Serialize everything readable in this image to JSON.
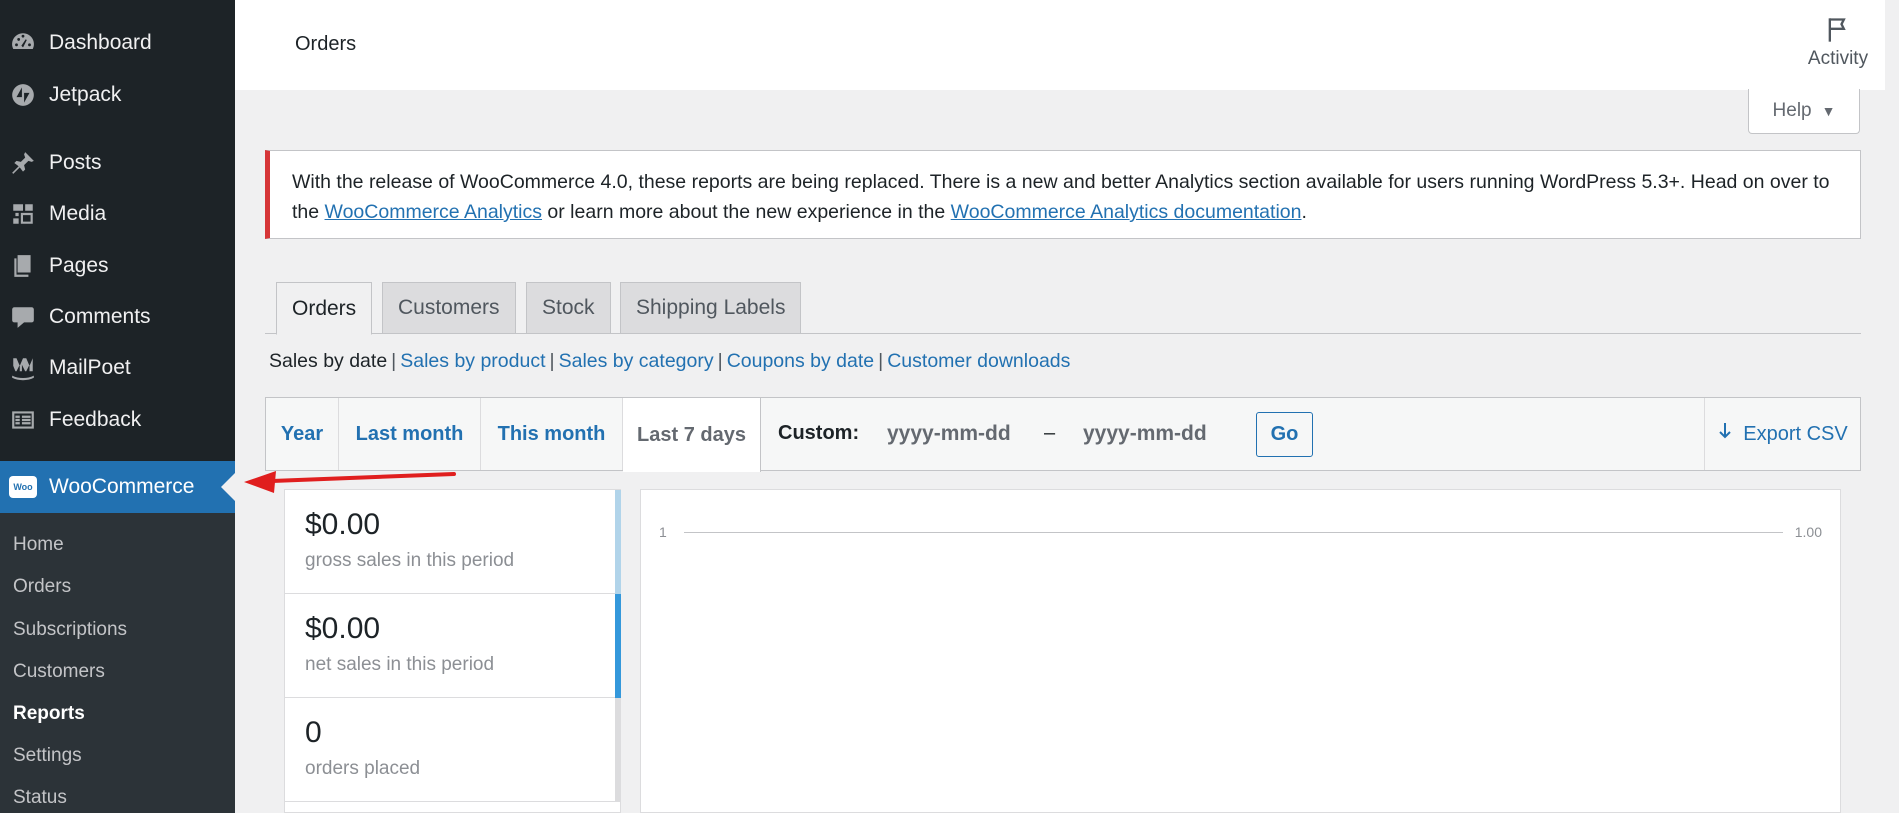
{
  "sidebar": {
    "items": [
      {
        "label": "Dashboard",
        "icon": "dashboard-icon"
      },
      {
        "label": "Jetpack",
        "icon": "jetpack-icon"
      },
      {
        "label": "Posts",
        "icon": "pin-icon"
      },
      {
        "label": "Media",
        "icon": "media-icon"
      },
      {
        "label": "Pages",
        "icon": "pages-icon"
      },
      {
        "label": "Comments",
        "icon": "comment-icon"
      },
      {
        "label": "MailPoet",
        "icon": "mailpoet-icon"
      },
      {
        "label": "Feedback",
        "icon": "feedback-icon"
      },
      {
        "label": "WooCommerce",
        "icon": "woocommerce-icon",
        "active": true
      }
    ],
    "woo_badge": "Woo",
    "submenu": [
      "Home",
      "Orders",
      "Subscriptions",
      "Customers",
      "Reports",
      "Settings",
      "Status"
    ],
    "current_submenu": "Reports"
  },
  "header": {
    "title": "Orders",
    "activity_label": "Activity"
  },
  "help_label": "Help",
  "notice": {
    "text_1": "With the release of WooCommerce 4.0, these reports are being replaced. There is a new and better Analytics section available for users running WordPress 5.3+. Head on over to the ",
    "link_1": "WooCommerce Analytics",
    "text_2": " or learn more about the new experience in the ",
    "link_2": "WooCommerce Analytics documentation",
    "text_3": "."
  },
  "tabs": [
    {
      "label": "Orders",
      "active": true
    },
    {
      "label": "Customers"
    },
    {
      "label": "Stock"
    },
    {
      "label": "Shipping Labels"
    }
  ],
  "subnav": {
    "current": "Sales by date",
    "links": [
      "Sales by product",
      "Sales by category",
      "Coupons by date",
      "Customer downloads"
    ],
    "separator": "|"
  },
  "ranges": [
    {
      "label": "Year"
    },
    {
      "label": "Last month"
    },
    {
      "label": "This month"
    },
    {
      "label": "Last 7 days",
      "active": true
    }
  ],
  "custom": {
    "label": "Custom:",
    "start_placeholder": "yyyy-mm-dd",
    "end_placeholder": "yyyy-mm-dd",
    "dash": "–",
    "go_label": "Go"
  },
  "export_label": "Export CSV",
  "legend": [
    {
      "amount": "$0.00",
      "desc": "gross sales in this period"
    },
    {
      "amount": "$0.00",
      "desc": "net sales in this period"
    },
    {
      "amount": "0",
      "desc": "orders placed"
    }
  ],
  "chart": {
    "y_left_label": "1",
    "y_right_label": "1.00"
  },
  "colors": {
    "sidebar_bg": "#1d2327",
    "active_blue": "#2271b1",
    "notice_red": "#d63638",
    "annotation_red": "#e01e1e"
  }
}
